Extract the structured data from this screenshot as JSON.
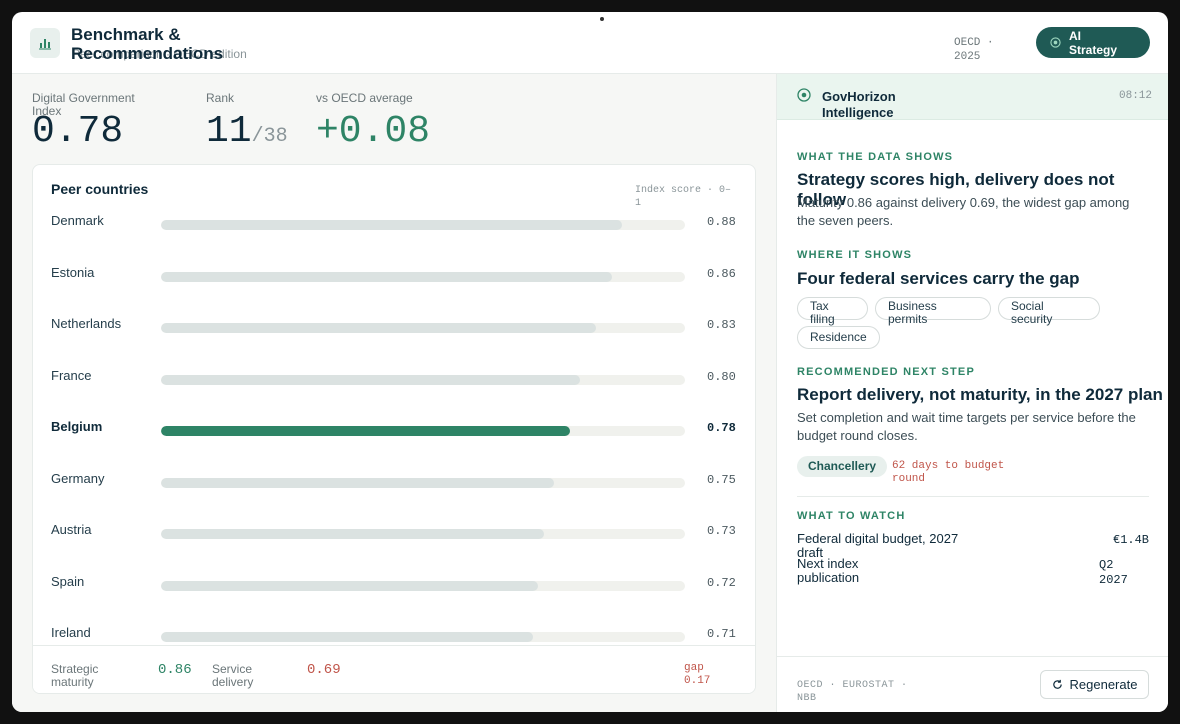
{
  "header": {
    "title": "Benchmark & Recommendations",
    "subtitle": "Peer comparison · OECD edition",
    "meta": "OECD · 2025",
    "ai_button": "AI Strategy"
  },
  "kpis": {
    "index_label": "Digital Government Index",
    "index_value": "0.78",
    "rank_label": "Rank",
    "rank_value": "11",
    "rank_total": "/38",
    "delta_label": "vs OECD average",
    "delta_value": "+0.08"
  },
  "peers": {
    "title": "Peer countries",
    "note": "Index score · 0–1",
    "rows": [
      {
        "country": "Denmark",
        "score": "0.88",
        "value": 0.88
      },
      {
        "country": "Estonia",
        "score": "0.86",
        "value": 0.86
      },
      {
        "country": "Netherlands",
        "score": "0.83",
        "value": 0.83
      },
      {
        "country": "France",
        "score": "0.80",
        "value": 0.8
      },
      {
        "country": "Belgium",
        "score": "0.78",
        "value": 0.78,
        "highlight": true
      },
      {
        "country": "Germany",
        "score": "0.75",
        "value": 0.75
      },
      {
        "country": "Austria",
        "score": "0.73",
        "value": 0.73
      },
      {
        "country": "Spain",
        "score": "0.72",
        "value": 0.72
      },
      {
        "country": "Ireland",
        "score": "0.71",
        "value": 0.71
      }
    ],
    "footer": {
      "maturity_label": "Strategic maturity",
      "maturity_value": "0.86",
      "delivery_label": "Service delivery",
      "delivery_value": "0.69",
      "gap": "gap 0.17"
    }
  },
  "assistant": {
    "title": "GovHorizon Intelligence",
    "time": "08:12",
    "s1_label": "WHAT THE DATA SHOWS",
    "s1_head": "Strategy scores high, delivery does not follow",
    "s1_body": "Maturity 0.86 against delivery 0.69, the widest gap among the seven peers.",
    "s2_label": "WHERE IT SHOWS",
    "s2_head": "Four federal services carry the gap",
    "chips": [
      "Tax filing",
      "Business permits",
      "Social security",
      "Residence"
    ],
    "s3_label": "RECOMMENDED NEXT STEP",
    "s3_head": "Report delivery, not maturity, in the 2027 plan",
    "s3_body": "Set completion and wait time targets per service before the budget round closes.",
    "owner": "Chancellery",
    "deadline": "62 days to budget round",
    "s4_label": "WHAT TO WATCH",
    "watch": [
      {
        "label": "Federal digital budget, 2027 draft",
        "value": "€1.4B"
      },
      {
        "label": "Next index publication",
        "value": "Q2 2027"
      }
    ],
    "sources": "OECD · EUROSTAT · NBB",
    "regenerate": "Regenerate"
  },
  "colors": {
    "accent": "#2e8466",
    "accent_dark": "#1f5a55",
    "warning": "#c0554a"
  }
}
